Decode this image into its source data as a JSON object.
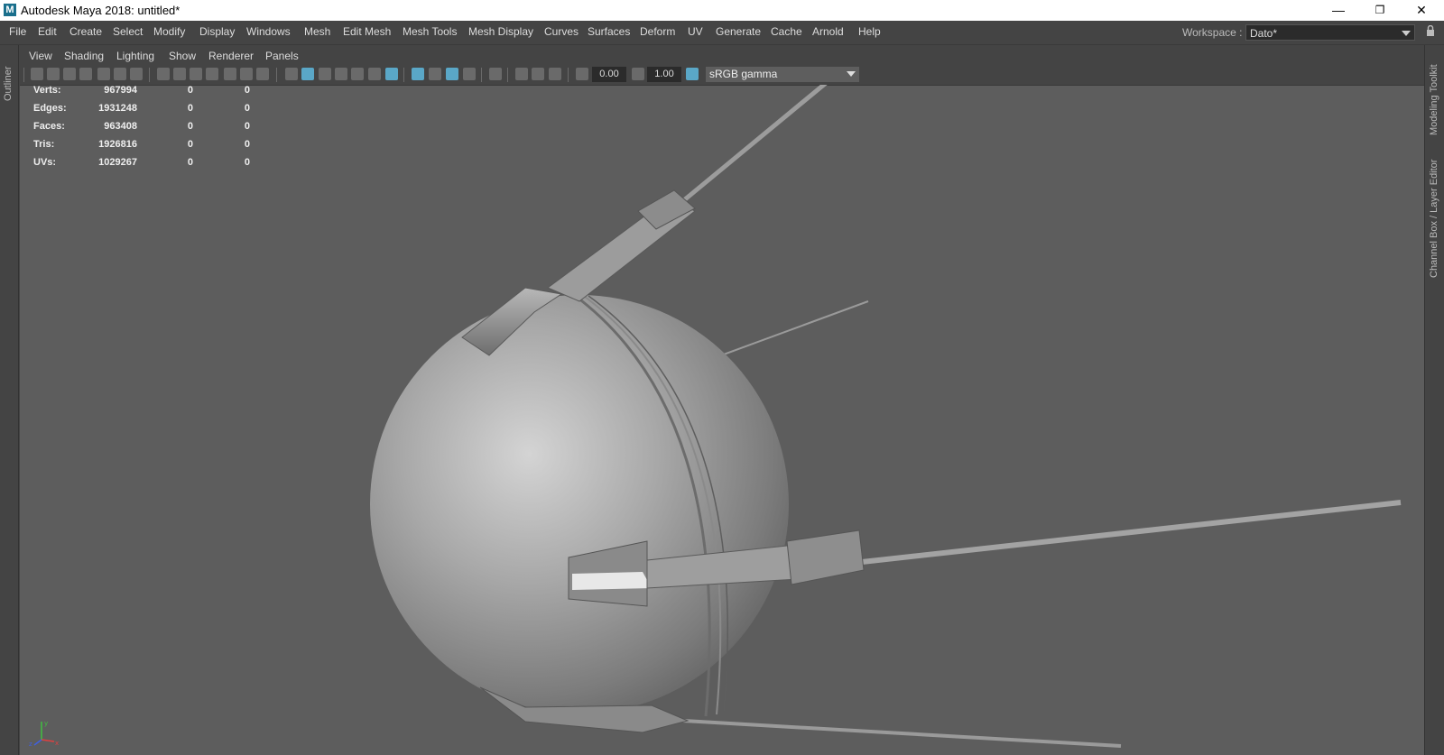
{
  "window": {
    "logo_letter": "M",
    "title": "Autodesk Maya 2018: untitled*",
    "minimize_glyph": "—",
    "restore_glyph": "❐",
    "close_glyph": "✕"
  },
  "menubar": {
    "items": [
      "File",
      "Edit",
      "Create",
      "Select",
      "Modify",
      "Display",
      "Windows",
      "Mesh",
      "Edit Mesh",
      "Mesh Tools",
      "Mesh Display",
      "Curves",
      "Surfaces",
      "Deform",
      "UV",
      "Generate",
      "Cache",
      "Arnold",
      "Help"
    ]
  },
  "workspace": {
    "label": "Workspace :",
    "value": "Dato*"
  },
  "outliner": {
    "label": "Outliner"
  },
  "right_dock": {
    "modeling_toolkit": "Modeling Toolkit",
    "channel_box": "Channel Box / Layer Editor"
  },
  "panel_menu": {
    "items": [
      "View",
      "Shading",
      "Lighting",
      "Show",
      "Renderer",
      "Panels"
    ]
  },
  "panel_toolbar": {
    "exposure": "0.00",
    "gamma": "1.00",
    "color_space": "sRGB gamma"
  },
  "hud": {
    "rows": [
      {
        "label": "Verts:",
        "v1": "967994",
        "v2": "0",
        "v3": "0"
      },
      {
        "label": "Edges:",
        "v1": "1931248",
        "v2": "0",
        "v3": "0"
      },
      {
        "label": "Faces:",
        "v1": "963408",
        "v2": "0",
        "v3": "0"
      },
      {
        "label": "Tris:",
        "v1": "1926816",
        "v2": "0",
        "v3": "0"
      },
      {
        "label": "UVs:",
        "v1": "1029267",
        "v2": "0",
        "v3": "0"
      }
    ]
  },
  "axis": {
    "x": "x",
    "y": "y",
    "z": "z"
  },
  "colors": {
    "accent": "#5aa7c7",
    "viewport_bg": "#5d5d5d",
    "ui_bg": "#444444",
    "axis_x": "#e04040",
    "axis_y": "#40c040",
    "axis_z": "#4060e0"
  }
}
